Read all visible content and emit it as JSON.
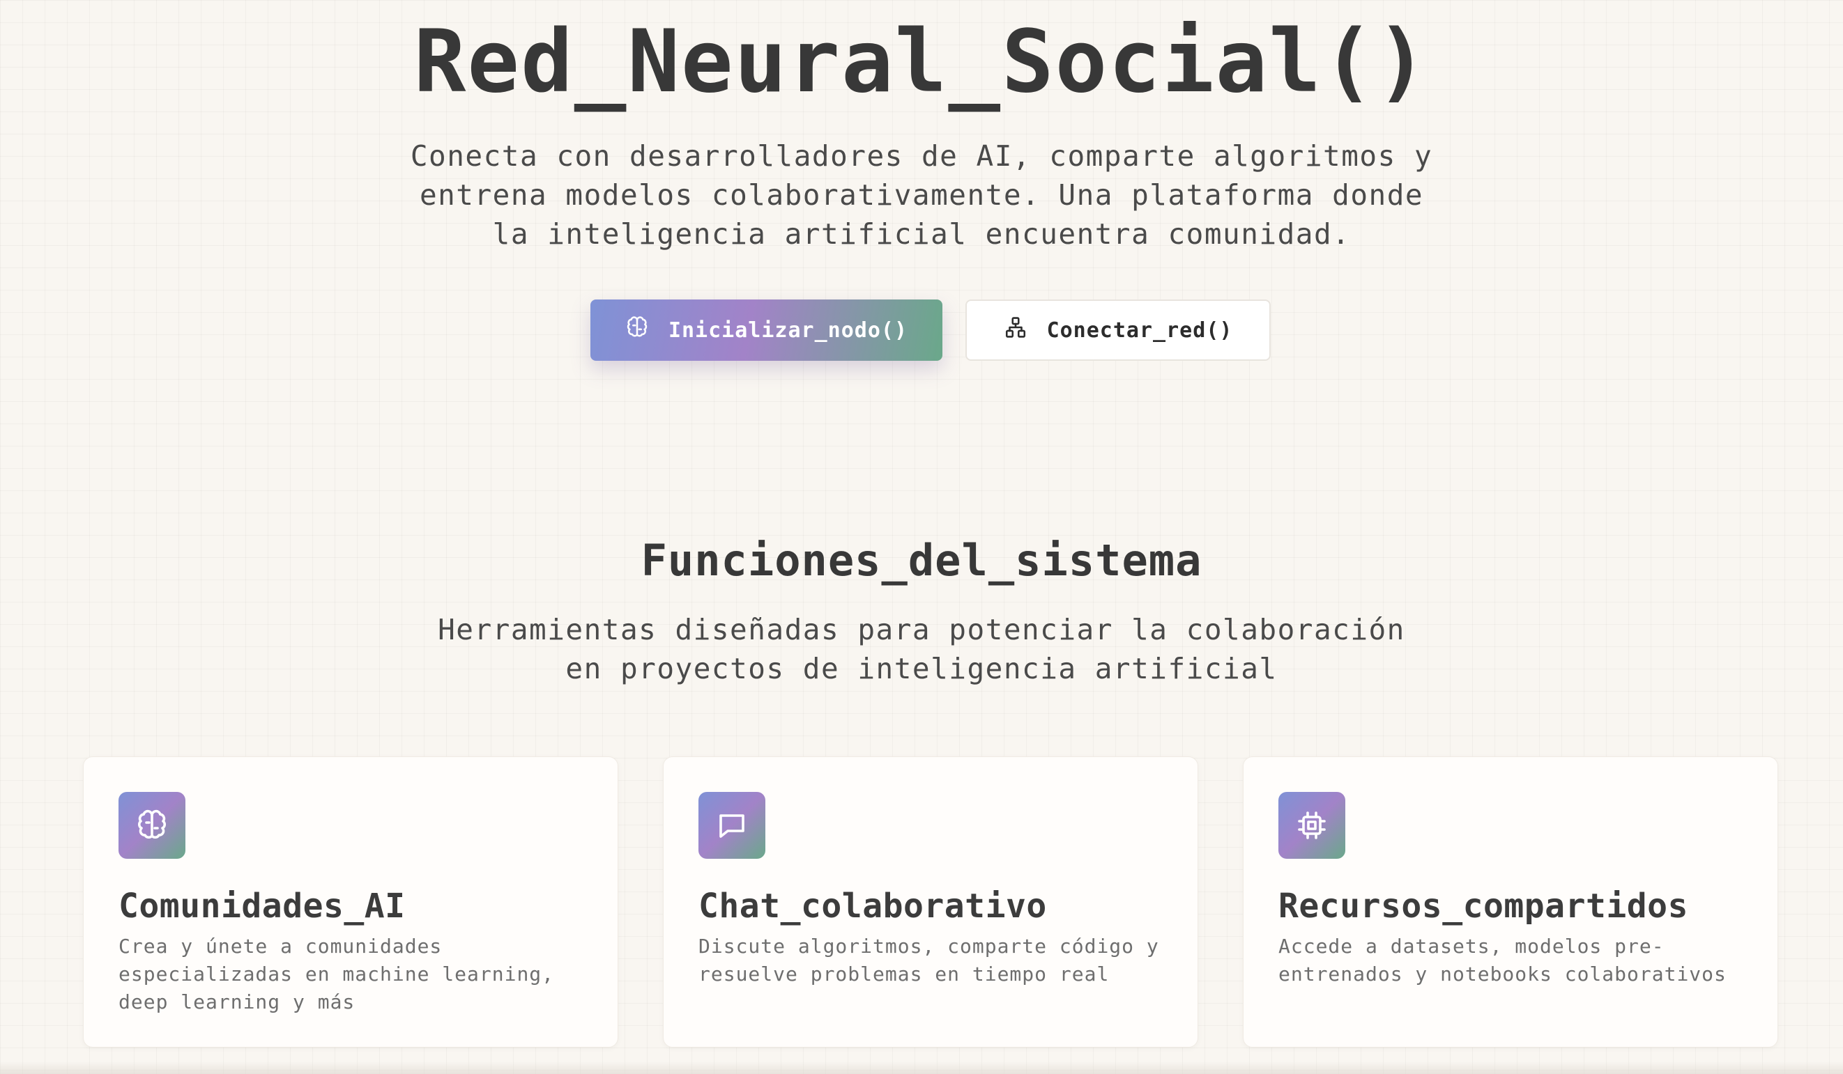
{
  "hero": {
    "title": "Red_Neural_Social()",
    "subtitle": "Conecta con desarrolladores de AI, comparte algoritmos y entrena modelos colaborativamente. Una plataforma donde la inteligencia artificial encuentra comunidad.",
    "primary_button": {
      "label": "Inicializar_nodo()",
      "icon": "brain-icon"
    },
    "secondary_button": {
      "label": "Conectar_red()",
      "icon": "network-icon"
    }
  },
  "features": {
    "title": "Funciones_del_sistema",
    "subtitle": "Herramientas diseñadas para potenciar la colaboración en proyectos de inteligencia artificial",
    "cards": [
      {
        "icon": "brain-icon",
        "title": "Comunidades_AI",
        "description": "Crea y únete a comunidades especializadas en machine learning, deep learning y más"
      },
      {
        "icon": "chat-bubble-icon",
        "title": "Chat_colaborativo",
        "description": "Discute algoritmos, comparte código y resuelve problemas en tiempo real"
      },
      {
        "icon": "cpu-chip-icon",
        "title": "Recursos_compartidos",
        "description": "Accede a datasets, modelos pre-entrenados y notebooks colaborativos"
      }
    ]
  },
  "colors": {
    "background": "#f9f6f1",
    "gradient_start": "#7f92d6",
    "gradient_mid": "#a283c8",
    "gradient_end": "#6aa88a",
    "text": "#383838"
  }
}
